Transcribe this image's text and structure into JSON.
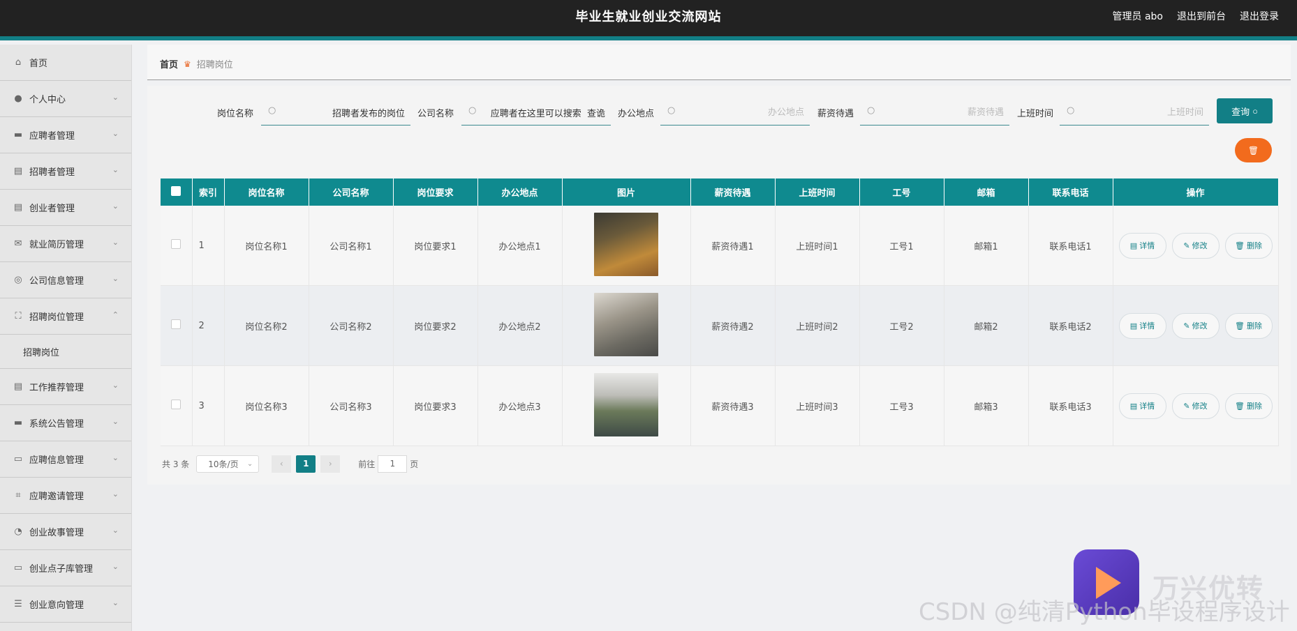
{
  "header": {
    "title": "毕业生就业创业交流网站",
    "links": [
      "管理员 abo",
      "退出到前台",
      "退出登录"
    ]
  },
  "sidebar": {
    "items": [
      {
        "label": "首页",
        "icon": "home-icon",
        "glyph": "⌂",
        "chevron": ""
      },
      {
        "label": "个人中心",
        "icon": "user-icon",
        "glyph": "●",
        "chevron": "⌄"
      },
      {
        "label": "应聘者管理",
        "icon": "monitor-icon",
        "glyph": "▬",
        "chevron": "⌄"
      },
      {
        "label": "招聘者管理",
        "icon": "clipboard-icon",
        "glyph": "▤",
        "chevron": "⌄"
      },
      {
        "label": "创业者管理",
        "icon": "clipboard-list-icon",
        "glyph": "▤",
        "chevron": "⌄"
      },
      {
        "label": "就业简历管理",
        "icon": "mail-icon",
        "glyph": "✉",
        "chevron": "⌄"
      },
      {
        "label": "公司信息管理",
        "icon": "compass-icon",
        "glyph": "◎",
        "chevron": "⌄"
      },
      {
        "label": "招聘岗位管理",
        "icon": "fullscreen-icon",
        "glyph": "⛶",
        "chevron": "⌃"
      },
      {
        "label": "工作推荐管理",
        "icon": "clipboard-check-icon",
        "glyph": "▤",
        "chevron": "⌄"
      },
      {
        "label": "系统公告管理",
        "icon": "briefcase-icon",
        "glyph": "▬",
        "chevron": "⌄"
      },
      {
        "label": "应聘信息管理",
        "icon": "id-card-icon",
        "glyph": "▭",
        "chevron": "⌄"
      },
      {
        "label": "应聘邀请管理",
        "icon": "crop-icon",
        "glyph": "⌗",
        "chevron": "⌄"
      },
      {
        "label": "创业故事管理",
        "icon": "gauge-icon",
        "glyph": "◔",
        "chevron": "⌄"
      },
      {
        "label": "创业点子库管理",
        "icon": "chat-icon",
        "glyph": "▭",
        "chevron": "⌄"
      },
      {
        "label": "创业意向管理",
        "icon": "list-icon",
        "glyph": "☰",
        "chevron": "⌄"
      }
    ],
    "submenu_label": "招聘岗位"
  },
  "breadcrumb": {
    "home": "首页",
    "current": "招聘岗位"
  },
  "search": {
    "fields": [
      {
        "label": "岗位名称",
        "value": "招聘者发布的岗位",
        "placeholder": ""
      },
      {
        "label": "公司名称",
        "value": "应聘者在这里可以搜索  查诡",
        "placeholder": ""
      },
      {
        "label": "办公地点",
        "value": "",
        "placeholder": "办公地点"
      },
      {
        "label": "薪资待遇",
        "value": "",
        "placeholder": "薪资待遇"
      },
      {
        "label": "上班时间",
        "value": "",
        "placeholder": "上班时间"
      }
    ],
    "query_label": "查询"
  },
  "table": {
    "headers": [
      "索引",
      "岗位名称",
      "公司名称",
      "岗位要求",
      "办公地点",
      "图片",
      "薪资待遇",
      "上班时间",
      "工号",
      "邮箱",
      "联系电话",
      "操作"
    ],
    "rows": [
      {
        "index": "1",
        "name": "岗位名称1",
        "company": "公司名称1",
        "req": "岗位要求1",
        "place": "办公地点1",
        "salary": "薪资待遇1",
        "time": "上班时间1",
        "id": "工号1",
        "email": "邮箱1",
        "phone": "联系电话1"
      },
      {
        "index": "2",
        "name": "岗位名称2",
        "company": "公司名称2",
        "req": "岗位要求2",
        "place": "办公地点2",
        "salary": "薪资待遇2",
        "time": "上班时间2",
        "id": "工号2",
        "email": "邮箱2",
        "phone": "联系电话2"
      },
      {
        "index": "3",
        "name": "岗位名称3",
        "company": "公司名称3",
        "req": "岗位要求3",
        "place": "办公地点3",
        "salary": "薪资待遇3",
        "time": "上班时间3",
        "id": "工号3",
        "email": "邮箱3",
        "phone": "联系电话3"
      }
    ],
    "ops": [
      "详情",
      "修改",
      "删除"
    ]
  },
  "pagination": {
    "total": "共 3 条",
    "page_size": "10条/页",
    "current_page": "1",
    "goto_label": "前往",
    "goto_value": "1",
    "page_suffix": "页"
  },
  "watermark": {
    "brand": "万兴优转",
    "csdn": "CSDN @纯清Python毕设程序设计"
  },
  "colors": {
    "accent": "#127f86",
    "orange": "#f26b1d",
    "header_bg": "#222222"
  }
}
